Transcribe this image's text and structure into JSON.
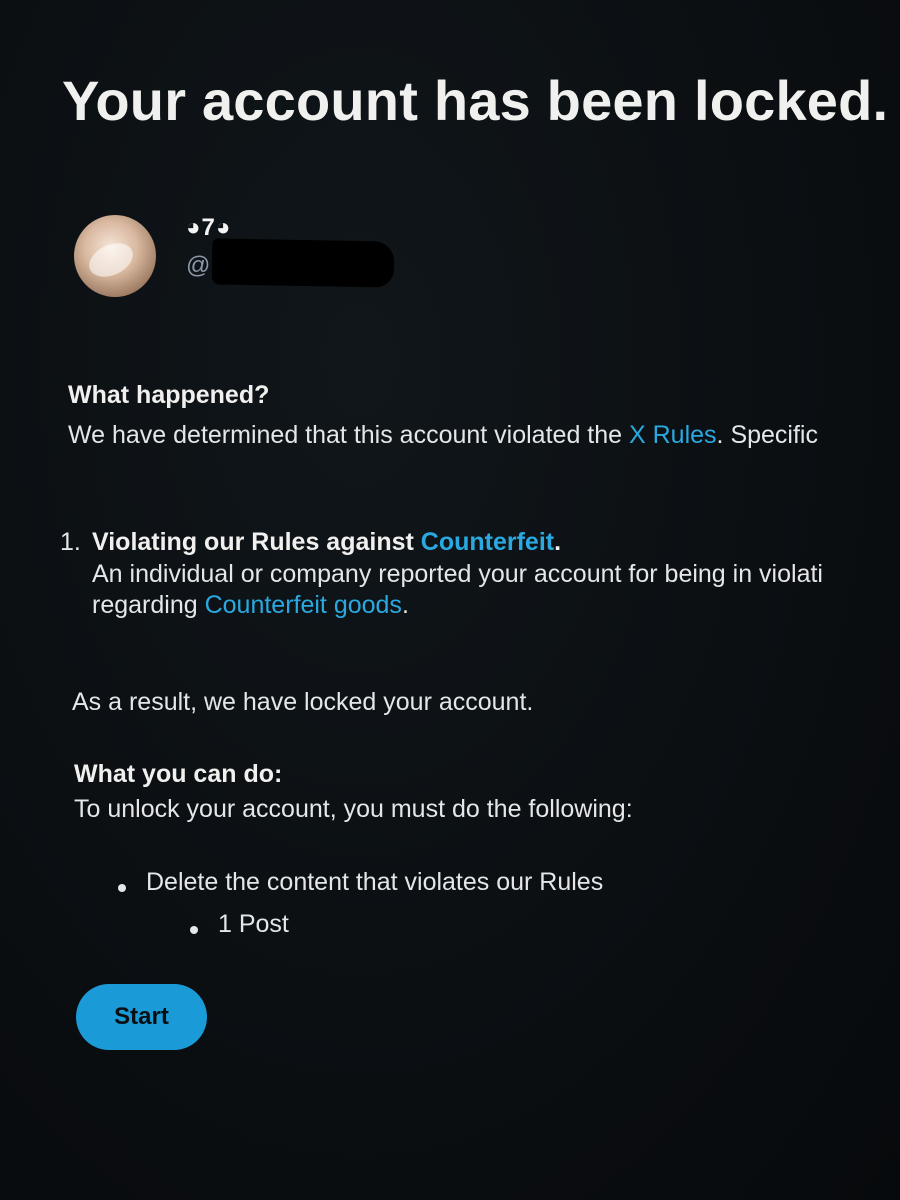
{
  "page": {
    "title": "Your account has been locked."
  },
  "profile": {
    "display_name": "◕7◕",
    "handle_prefix": "@"
  },
  "what_happened": {
    "heading": "What happened?",
    "text_before_link": "We have determined that this account violated the ",
    "link": "X Rules",
    "text_after_link": ". Specific"
  },
  "violation": {
    "number": "1.",
    "title_before": "Violating our Rules against ",
    "title_link": "Counterfeit",
    "title_after": ".",
    "line1": "An individual or company reported your account for being in violati",
    "line2_before": "regarding ",
    "line2_link": "Counterfeit goods",
    "line2_after": "."
  },
  "result": {
    "text": "As a result, we have locked your account."
  },
  "what_you_can_do": {
    "heading": "What you can do:",
    "text": "To unlock your account, you must do the following:",
    "items": [
      {
        "label": "Delete the content that violates our Rules",
        "sub_items": [
          "1 Post"
        ]
      }
    ]
  },
  "actions": {
    "start_label": "Start"
  },
  "colors": {
    "background": "#0b0f12",
    "link": "#2aa9e0",
    "button": "#1a9bd7"
  }
}
